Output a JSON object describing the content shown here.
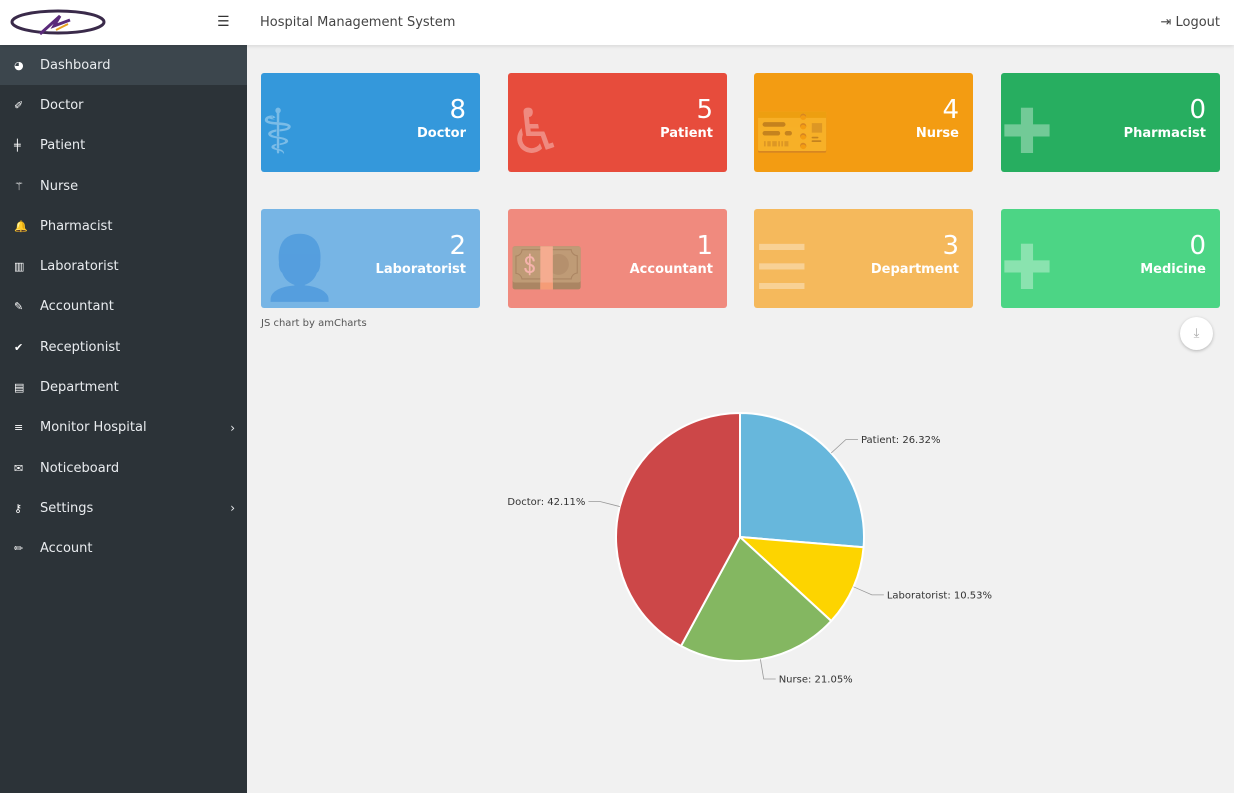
{
  "header": {
    "title": "Hospital Management System",
    "logout": "Logout"
  },
  "sidebar": {
    "items": [
      {
        "label": "Dashboard",
        "icon": "dashboard-icon",
        "glyph": "◕"
      },
      {
        "label": "Doctor",
        "icon": "brush-icon",
        "glyph": "✐"
      },
      {
        "label": "Patient",
        "icon": "plus-icon",
        "glyph": "╪"
      },
      {
        "label": "Nurse",
        "icon": "wand-icon",
        "glyph": "⚚"
      },
      {
        "label": "Pharmacist",
        "icon": "bell-icon",
        "glyph": "🔔"
      },
      {
        "label": "Laboratorist",
        "icon": "bar-chart-icon",
        "glyph": "▥"
      },
      {
        "label": "Accountant",
        "icon": "paperclip-icon",
        "glyph": "✎"
      },
      {
        "label": "Receptionist",
        "icon": "check-icon",
        "glyph": "✔"
      },
      {
        "label": "Department",
        "icon": "file-icon",
        "glyph": "▤"
      },
      {
        "label": "Monitor Hospital",
        "icon": "list-icon",
        "glyph": "≡",
        "chev": "›"
      },
      {
        "label": "Noticeboard",
        "icon": "envelope-icon",
        "glyph": "✉"
      },
      {
        "label": "Settings",
        "icon": "wrench-icon",
        "glyph": "⚷",
        "chev": "›"
      },
      {
        "label": "Account",
        "icon": "pencil-icon",
        "glyph": "✏"
      }
    ]
  },
  "cards": [
    {
      "value": "8",
      "label": "Doctor",
      "color": "#3498db",
      "icon": "doctor-icon",
      "glyph": "⚕"
    },
    {
      "value": "5",
      "label": "Patient",
      "color": "#e74c3c",
      "icon": "wheelchair-icon",
      "glyph": "♿"
    },
    {
      "value": "4",
      "label": "Nurse",
      "color": "#f39c12",
      "icon": "ticket-icon",
      "glyph": "🎫"
    },
    {
      "value": "0",
      "label": "Pharmacist",
      "color": "#27ae60",
      "icon": "medkit-icon",
      "glyph": "✚"
    },
    {
      "value": "2",
      "label": "Laboratorist",
      "color": "#77b5e5",
      "icon": "user-icon",
      "glyph": "👤"
    },
    {
      "value": "1",
      "label": "Accountant",
      "color": "#f08a7e",
      "icon": "money-icon",
      "glyph": "💵"
    },
    {
      "value": "3",
      "label": "Department",
      "color": "#f5b95c",
      "icon": "list-alt-icon",
      "glyph": "☰"
    },
    {
      "value": "0",
      "label": "Medicine",
      "color": "#4cd585",
      "icon": "medkit-icon",
      "glyph": "✚"
    }
  ],
  "credit": "JS chart by amCharts",
  "chart_data": {
    "type": "pie",
    "slices": [
      {
        "name": "Patient",
        "value": 5,
        "percent": "26.32%",
        "color": "#67b7dc"
      },
      {
        "name": "Laboratorist",
        "value": 2,
        "percent": "10.53%",
        "color": "#fdd400"
      },
      {
        "name": "Nurse",
        "value": 4,
        "percent": "21.05%",
        "color": "#84b761"
      },
      {
        "name": "Doctor",
        "value": 8,
        "percent": "42.11%",
        "color": "#cc4748"
      }
    ]
  }
}
